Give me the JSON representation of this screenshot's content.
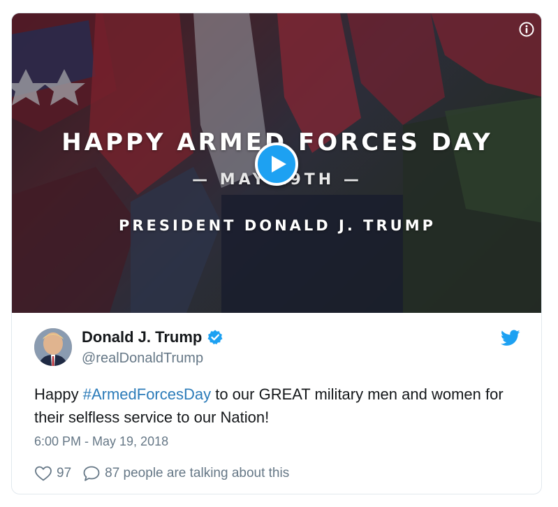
{
  "media": {
    "headline": "HAPPY ARMED FORCES DAY",
    "date_line": "— MAY 19TH —",
    "credit": "PRESIDENT DONALD J. TRUMP",
    "play_icon": "play-icon",
    "info_icon": "info-icon"
  },
  "author": {
    "display_name": "Donald J. Trump",
    "handle": "@realDonaldTrump",
    "verified_icon": "verified-badge-icon",
    "avatar_icon": "avatar"
  },
  "tweet": {
    "text_prefix": "Happy ",
    "hashtag": "#ArmedForcesDay",
    "text_suffix": " to our GREAT military men and women for their selfless service to our Nation!",
    "timestamp": "6:00 PM - May 19, 2018"
  },
  "actions": {
    "like_count": "97",
    "talking_text": "87 people are talking about this"
  },
  "colors": {
    "accent": "#1da1f2",
    "link": "#2b7bb9",
    "muted": "#657786",
    "text": "#14171a"
  }
}
